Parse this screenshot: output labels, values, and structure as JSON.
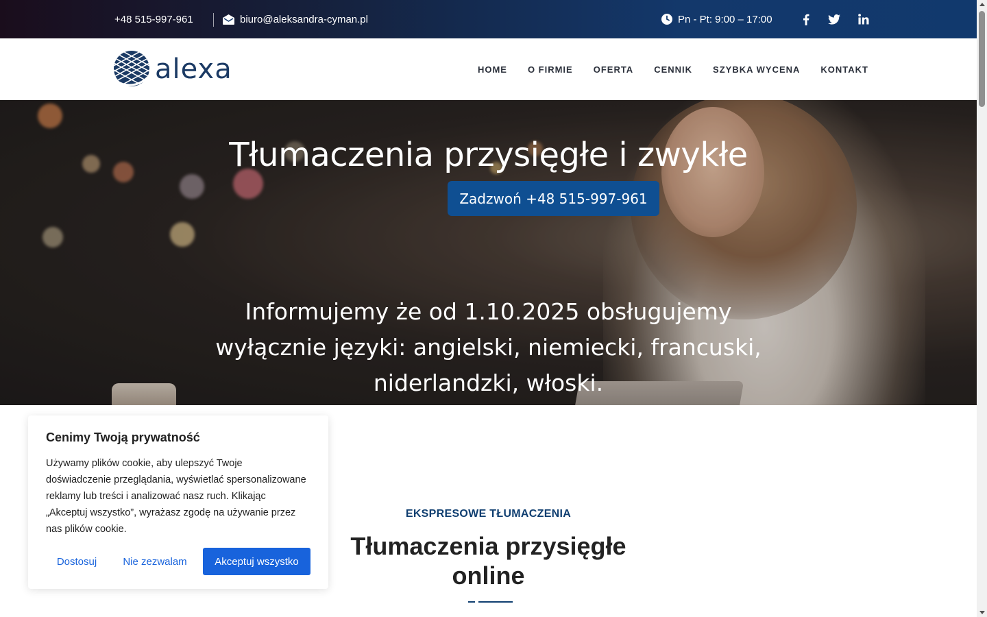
{
  "topbar": {
    "phone": "+48 515-997-961",
    "email": "biuro@aleksandra-cyman.pl",
    "hours": "Pn - Pt: 9:00 – 17:00",
    "social_icons": [
      "facebook-icon",
      "twitter-icon",
      "linkedin-icon"
    ]
  },
  "header": {
    "logo_text": "alexa",
    "nav": [
      "HOME",
      "O FIRMIE",
      "OFERTA",
      "CENNIK",
      "SZYBKA WYCENA",
      "KONTAKT"
    ]
  },
  "hero": {
    "title": "Tłumaczenia przysięgłe i zwykłe",
    "cta_label": "Zadzwoń +48 515-997-961",
    "notice": "Informujemy że od 1.10.2025 obsługujemy wyłącznie języki: angielski, niemiecki, francuski, niderlandzki, włoski."
  },
  "section": {
    "kicker": "EKSPRESOWE TŁUMACZENIA",
    "title": "Tłumaczenia przysięgłe online"
  },
  "cookie": {
    "title": "Cenimy Twoją prywatność",
    "text": "Używamy plików cookie, aby ulepszyć Twoje doświadczenie przeglądania, wyświetlać spersonalizowane reklamy lub treści i analizować nasz ruch. Klikając „Akceptuj wszystko”, wyrażasz zgodę na używanie przez nas plików cookie.",
    "customize_label": "Dostosuj",
    "reject_label": "Nie zezwalam",
    "accept_label": "Akceptuj wszystko"
  },
  "colors": {
    "brand_blue": "#0f4f92",
    "accent_blue": "#1863dc",
    "topbar_dark": "#13386b"
  }
}
